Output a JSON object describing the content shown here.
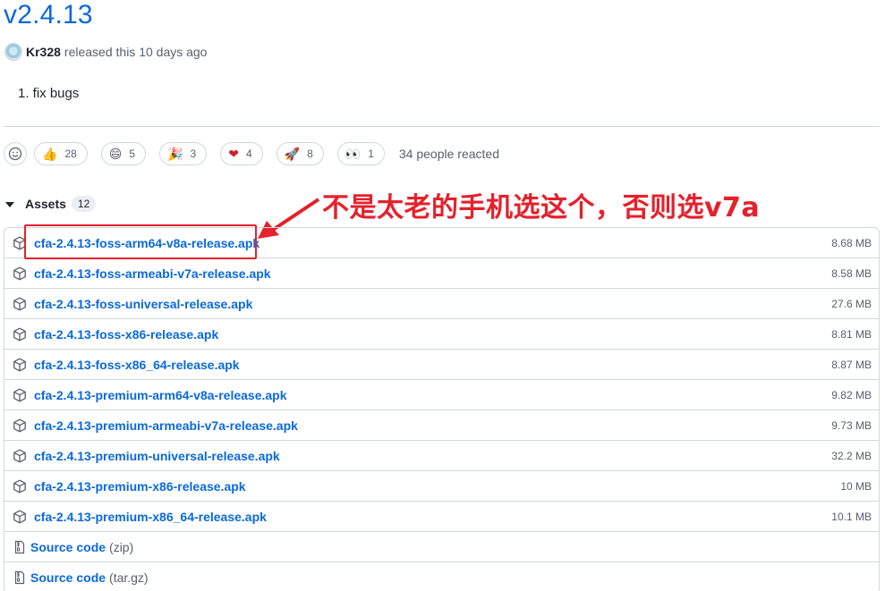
{
  "release": {
    "version": "v2.4.13",
    "author": "Kr328",
    "released_text": "released this 10 days ago",
    "notes": "1. fix bugs"
  },
  "reactions": {
    "items": [
      {
        "icon": "thumbs-up-icon",
        "emoji": "👍",
        "count": "28"
      },
      {
        "icon": "laugh-icon",
        "emoji": "😄",
        "count": "5"
      },
      {
        "icon": "tada-icon",
        "emoji": "🎉",
        "count": "3"
      },
      {
        "icon": "heart-icon",
        "emoji": "❤",
        "count": "4"
      },
      {
        "icon": "rocket-icon",
        "emoji": "🚀",
        "count": "8"
      },
      {
        "icon": "eyes-icon",
        "emoji": "👀",
        "count": "1"
      }
    ],
    "summary": "34 people reacted"
  },
  "assets": {
    "title": "Assets",
    "count": "12",
    "files": [
      {
        "name": "cfa-2.4.13-foss-arm64-v8a-release.apk",
        "size": "8.68 MB"
      },
      {
        "name": "cfa-2.4.13-foss-armeabi-v7a-release.apk",
        "size": "8.58 MB"
      },
      {
        "name": "cfa-2.4.13-foss-universal-release.apk",
        "size": "27.6 MB"
      },
      {
        "name": "cfa-2.4.13-foss-x86-release.apk",
        "size": "8.81 MB"
      },
      {
        "name": "cfa-2.4.13-foss-x86_64-release.apk",
        "size": "8.87 MB"
      },
      {
        "name": "cfa-2.4.13-premium-arm64-v8a-release.apk",
        "size": "9.82 MB"
      },
      {
        "name": "cfa-2.4.13-premium-armeabi-v7a-release.apk",
        "size": "9.73 MB"
      },
      {
        "name": "cfa-2.4.13-premium-universal-release.apk",
        "size": "32.2 MB"
      },
      {
        "name": "cfa-2.4.13-premium-x86-release.apk",
        "size": "10 MB"
      },
      {
        "name": "cfa-2.4.13-premium-x86_64-release.apk",
        "size": "10.1 MB"
      }
    ],
    "source": [
      {
        "label": "Source code",
        "ext": "(zip)"
      },
      {
        "label": "Source code",
        "ext": "(tar.gz)"
      }
    ]
  },
  "annotation": {
    "text": "不是太老的手机选这个，否则选v7a",
    "color": "#e5212b"
  },
  "colors": {
    "link": "#0969da",
    "border": "#d0d7de",
    "muted": "#57606a"
  }
}
